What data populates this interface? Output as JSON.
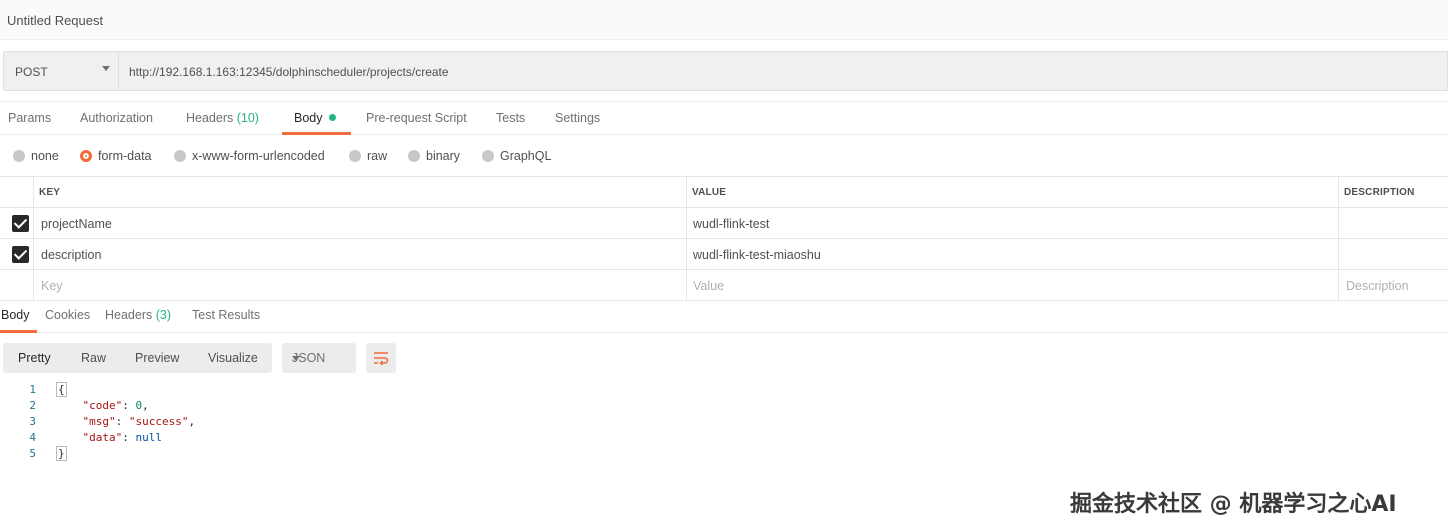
{
  "header": {
    "title": "Untitled Request"
  },
  "request": {
    "method": "POST",
    "url": "http://192.168.1.163:12345/dolphinscheduler/projects/create"
  },
  "request_tabs": [
    {
      "label": "Params"
    },
    {
      "label": "Authorization"
    },
    {
      "label": "Headers",
      "count": "(10)"
    },
    {
      "label": "Body"
    },
    {
      "label": "Pre-request Script"
    },
    {
      "label": "Tests"
    },
    {
      "label": "Settings"
    }
  ],
  "body_types": [
    "none",
    "form-data",
    "x-www-form-urlencoded",
    "raw",
    "binary",
    "GraphQL"
  ],
  "body_type_selected": "form-data",
  "form_table": {
    "headers": {
      "key": "KEY",
      "value": "VALUE",
      "description": "DESCRIPTION"
    },
    "rows": [
      {
        "key": "projectName",
        "value": "wudl-flink-test",
        "checked": true
      },
      {
        "key": "description",
        "value": "wudl-flink-test-miaoshu",
        "checked": true
      }
    ],
    "placeholders": {
      "key": "Key",
      "value": "Value",
      "description": "Description"
    }
  },
  "response_tabs": [
    {
      "label": "Body"
    },
    {
      "label": "Cookies"
    },
    {
      "label": "Headers",
      "count": "(3)"
    },
    {
      "label": "Test Results"
    }
  ],
  "view_modes": [
    "Pretty",
    "Raw",
    "Preview",
    "Visualize"
  ],
  "format": "JSON",
  "response_lines": [
    {
      "num": "1",
      "text": "{"
    },
    {
      "num": "2",
      "key": "\"code\"",
      "value": "0",
      "end": ","
    },
    {
      "num": "3",
      "key": "\"msg\"",
      "value": "\"success\"",
      "end": ","
    },
    {
      "num": "4",
      "key": "\"data\"",
      "value": "null",
      "end": ""
    },
    {
      "num": "5",
      "text": "}"
    }
  ],
  "watermark": "掘金技术社区 @ 机器学习之心AI",
  "colors": {
    "accent": "#f26b3a",
    "success": "#26b47f"
  }
}
